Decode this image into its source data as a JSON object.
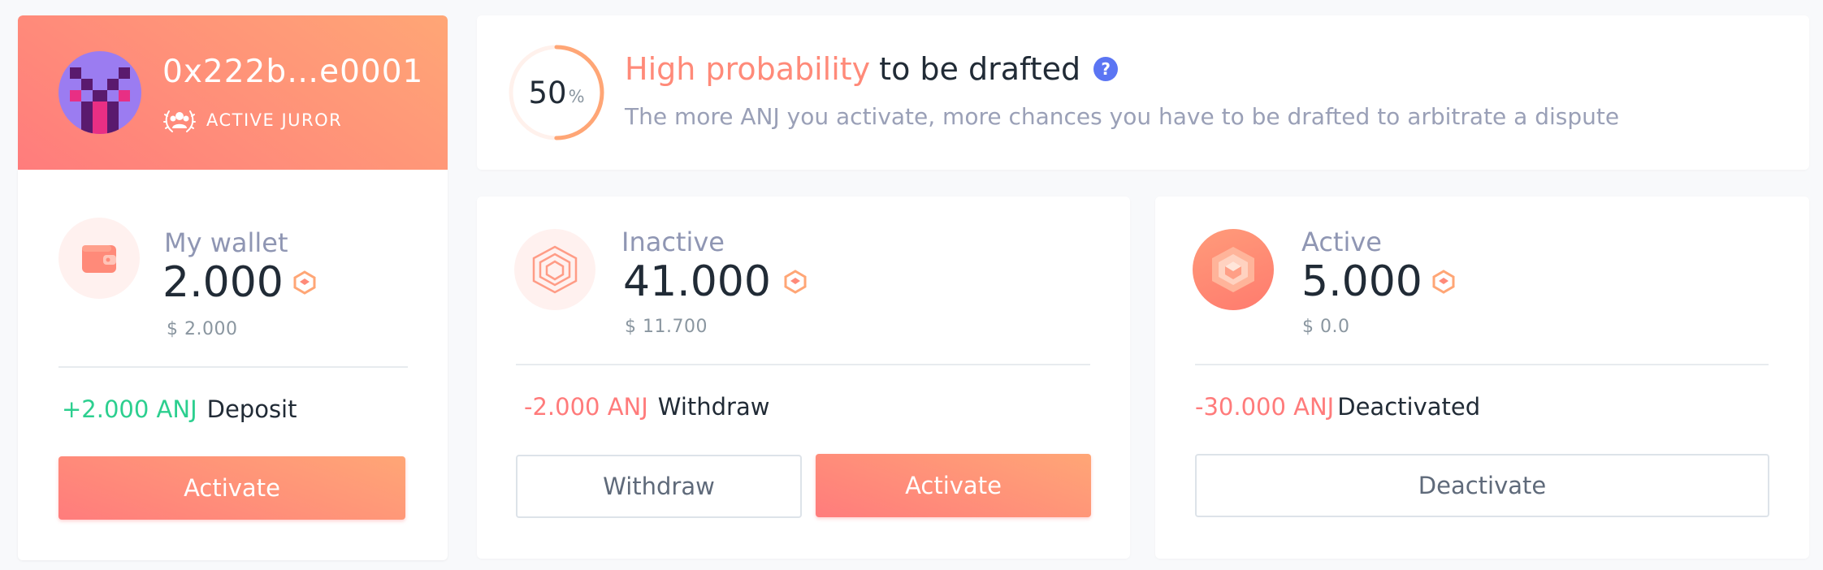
{
  "profile": {
    "address": "0x222b…e0001",
    "role_label": "ACTIVE JUROR",
    "avatar_icon": "identicon-avatar",
    "badge_icon": "juror-laurel-icon"
  },
  "probability": {
    "percent_value": "50",
    "percent_sign": "%",
    "percent_fraction": 0.5,
    "title_accent": "High probability",
    "title_rest": "to be drafted",
    "help_icon_glyph": "?",
    "description": "The more ANJ you activate, more chances you have to be drafted to arbitrate a dispute"
  },
  "wallet": {
    "icon": "wallet-icon",
    "label": "My wallet",
    "amount": "2.000",
    "usd": "$ 2.000",
    "change_amount": "+2.000 ANJ",
    "change_desc": "Deposit",
    "activate_label": "Activate"
  },
  "inactive": {
    "icon": "inactive-anj-icon",
    "label": "Inactive",
    "amount": "41.000",
    "usd": "$ 11.700",
    "change_amount": "-2.000 ANJ",
    "change_desc": "Withdraw",
    "withdraw_label": "Withdraw",
    "activate_label": "Activate"
  },
  "active": {
    "icon": "active-anj-icon",
    "label": "Active",
    "amount": "5.000",
    "usd": "$ 0.0",
    "change_amount": "-30.000 ANJ",
    "change_desc": "Deactivated",
    "deactivate_label": "Deactivate"
  },
  "colors": {
    "accent_gradient_start": "#ff7c7c",
    "accent_gradient_end": "#ffa676",
    "positive": "#2ccf8f",
    "negative": "#ff7b7b",
    "help_blue": "#5b75f3",
    "label_gray": "#8f96b3"
  }
}
